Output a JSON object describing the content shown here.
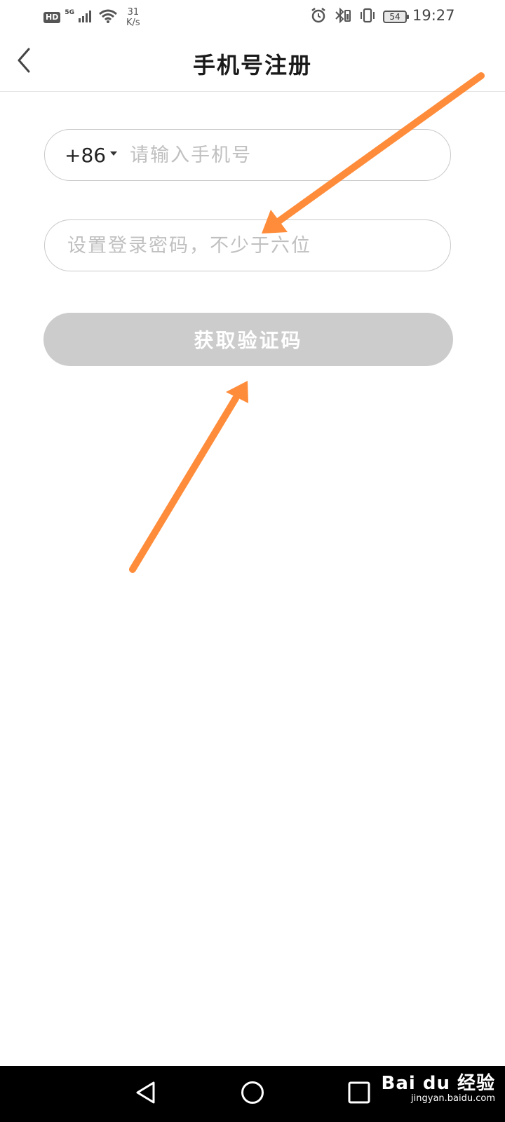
{
  "status_bar": {
    "hd": "HD",
    "network": "5G",
    "speed_value": "31",
    "speed_unit": "K/s",
    "battery": "54",
    "time": "19:27",
    "icons": [
      "signal-icon",
      "wifi-icon",
      "alarm-icon",
      "bluetooth-icon",
      "vibrate-icon",
      "battery-icon"
    ]
  },
  "header": {
    "title": "手机号注册",
    "back_icon": "chevron-left-icon"
  },
  "form": {
    "country_code": "+86",
    "phone_placeholder": "请输入手机号",
    "password_placeholder": "设置登录密码，不少于六位",
    "submit_label": "获取验证码"
  },
  "colors": {
    "annotation_arrow": "#ff8c3a",
    "button_disabled": "#cccccc",
    "field_border": "#c8c8c8",
    "placeholder": "#c0c0c0"
  },
  "navigation": {
    "icons": [
      "nav-back-icon",
      "nav-home-icon",
      "nav-recent-icon"
    ]
  },
  "watermark": {
    "logo": "Bai du 经验",
    "url": "jingyan.baidu.com"
  }
}
